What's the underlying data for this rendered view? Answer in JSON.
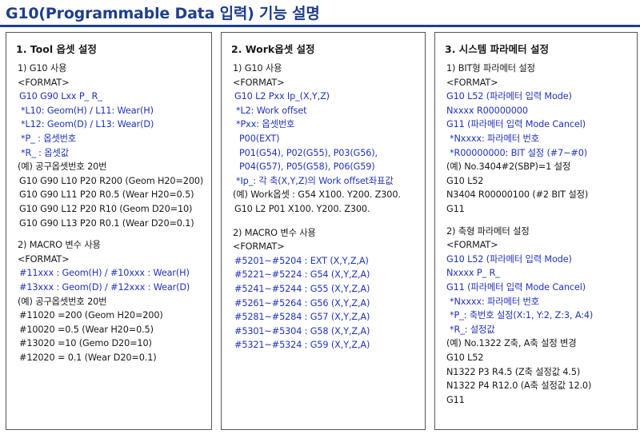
{
  "page": {
    "title": "G10(Programmable Data 입력) 기능 설명"
  },
  "colors": {
    "title": "#1f3f8a",
    "text": "#1a1a1a",
    "highlight": "#2233bb",
    "border": "#555555"
  },
  "panels": [
    {
      "title": "1. Tool 옵셋 설정",
      "lines": [
        {
          "text": "1) G10 사용",
          "color": "black"
        },
        {
          "text": "<FORMAT>",
          "color": "black"
        },
        {
          "text": "G10 G90 Lxx P_ R_",
          "color": "blue"
        },
        {
          "text": "*L10: Geom(H) / L11: Wear(H)",
          "color": "blue"
        },
        {
          "text": "*L12: Geom(D) / L13: Wear(D)",
          "color": "blue"
        },
        {
          "text": "*P_ : 옵셋번호",
          "color": "blue"
        },
        {
          "text": "*R_ : 옵셋값",
          "color": "blue"
        },
        {
          "text": "(예) 공구옵셋번호 20번",
          "color": "black"
        },
        {
          "text": "G10 G90 L10 P20 R200 (Geom H20=200)",
          "color": "black"
        },
        {
          "text": "G10 G90 L11 P20 R0.5 (Wear H20=0.5)",
          "color": "black"
        },
        {
          "text": "G10 G90 L12 P20 R10 (Geom D20=10)",
          "color": "black"
        },
        {
          "text": "G10 G90 L13 P20 R0.1 (Wear D20=0.1)",
          "color": "black"
        },
        {
          "text": "2) MACRO 변수 사용",
          "color": "black"
        },
        {
          "text": "<FORMAT>",
          "color": "black"
        },
        {
          "text": "#11xxx : Geom(H) / #10xxx : Wear(H)",
          "color": "blue"
        },
        {
          "text": "#13xxx : Geom(D) / #12xxx : Wear(D)",
          "color": "blue"
        },
        {
          "text": "(예) 공구옵셋번호 20번",
          "color": "black"
        },
        {
          "text": "#11020 =200 (Geom H20=200)",
          "color": "black"
        },
        {
          "text": "#10020 =0.5 (Wear H20=0.5)",
          "color": "black"
        },
        {
          "text": "#13020 =10 (Gemo D20=10)",
          "color": "black"
        },
        {
          "text": "#12020 = 0.1 (Wear D20=0.1)",
          "color": "black"
        }
      ]
    },
    {
      "title": "2. Work옵셋 설정",
      "lines": [
        {
          "text": "1) G10 사용",
          "color": "black"
        },
        {
          "text": "<FORMAT>",
          "color": "black"
        },
        {
          "text": "G10 L2 Pxx Ip_(X,Y,Z)",
          "color": "blue"
        },
        {
          "text": "*L2: Work offset",
          "color": "blue"
        },
        {
          "text": "*Pxx: 옵셋번호",
          "color": "blue"
        },
        {
          "text": "P00(EXT)",
          "color": "blue"
        },
        {
          "text": "P01(G54), P02(G55), P03(G56),",
          "color": "blue"
        },
        {
          "text": "P04(G57), P05(G58), P06(G59)",
          "color": "blue"
        },
        {
          "text": "*Ip_: 각 축(X,Y,Z)의 Work offset좌표값",
          "color": "blue"
        },
        {
          "text": "(예) Work옵셋 : G54 X100. Y200. Z300.",
          "color": "black"
        },
        {
          "text": "G10 L2 P01 X100. Y200. Z300.",
          "color": "black"
        },
        {
          "text": "2) MACRO 변수 사용",
          "color": "black"
        },
        {
          "text": "<FORMAT>",
          "color": "black"
        },
        {
          "text": "#5201~#5204 : EXT (X,Y,Z,A)",
          "color": "blue"
        },
        {
          "text": "#5221~#5224 : G54 (X,Y,Z,A)",
          "color": "blue"
        },
        {
          "text": "#5241~#5244 : G55 (X,Y,Z,A)",
          "color": "blue"
        },
        {
          "text": "#5261~#5264 : G56 (X,Y,Z,A)",
          "color": "blue"
        },
        {
          "text": "#5281~#5284 : G57 (X,Y,Z,A)",
          "color": "blue"
        },
        {
          "text": "#5301~#5304 : G58 (X,Y,Z,A)",
          "color": "blue"
        },
        {
          "text": "#5321~#5324 : G59 (X,Y,Z,A)",
          "color": "blue"
        }
      ]
    },
    {
      "title": "3. 시스템 파라메터 설정",
      "lines": [
        {
          "text": "1) BIT형 파라메터 설정",
          "color": "black"
        },
        {
          "text": "<FORMAT>",
          "color": "black"
        },
        {
          "text": "G10 L52 (파라메터 입력 Mode)",
          "color": "blue"
        },
        {
          "text": "Nxxxx R00000000",
          "color": "blue"
        },
        {
          "text": "G11 (파라메터 입력 Mode Cancel)",
          "color": "blue"
        },
        {
          "text": "*Nxxxx: 파라메터 번호",
          "color": "blue"
        },
        {
          "text": "*R00000000: BIT 설정 (#7~#0)",
          "color": "blue"
        },
        {
          "text": "(예) No.3404#2(SBP)=1 설정",
          "color": "black"
        },
        {
          "text": "G10 L52",
          "color": "black"
        },
        {
          "text": "N3404 R00000100 (#2 BIT 설정)",
          "color": "black"
        },
        {
          "text": "G11",
          "color": "black"
        },
        {
          "text": "2) 축형 파라메터 설정",
          "color": "black"
        },
        {
          "text": "<FORMAT>",
          "color": "black"
        },
        {
          "text": "G10 L52 (파라메터 입력 Mode)",
          "color": "blue"
        },
        {
          "text": "Nxxxx P_ R_",
          "color": "blue"
        },
        {
          "text": "G11 (파라메터 입력 Mode Cancel)",
          "color": "blue"
        },
        {
          "text": "*Nxxxx: 파라메터 번호",
          "color": "blue"
        },
        {
          "text": "*P_: 축번호 설정(X:1, Y:2, Z:3, A:4)",
          "color": "blue"
        },
        {
          "text": "*R_: 설정값",
          "color": "blue"
        },
        {
          "text": "(예) No.1322 Z축, A축 설정 변경",
          "color": "black"
        },
        {
          "text": "G10 L52",
          "color": "black"
        },
        {
          "text": "N1322 P3 R4.5 (Z축 설정값 4.5)",
          "color": "black"
        },
        {
          "text": "N1322 P4 R12.0 (A축 설정값 12.0)",
          "color": "black"
        },
        {
          "text": "G11",
          "color": "black"
        }
      ]
    }
  ]
}
